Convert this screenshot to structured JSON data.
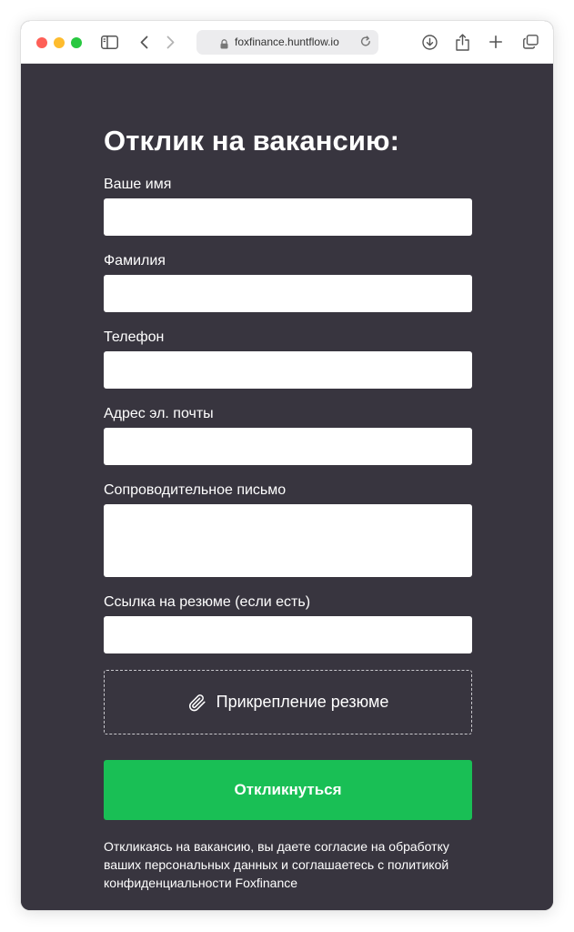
{
  "browser": {
    "url": "foxfinance.huntflow.io"
  },
  "form": {
    "title": "Отклик на вакансию:",
    "first_name": {
      "label": "Ваше имя",
      "value": ""
    },
    "last_name": {
      "label": "Фамилия",
      "value": ""
    },
    "phone": {
      "label": "Телефон",
      "value": ""
    },
    "email": {
      "label": "Адрес эл. почты",
      "value": ""
    },
    "cover_letter": {
      "label": "Сопроводительное письмо",
      "value": ""
    },
    "resume_link": {
      "label": "Ссылка на резюме (если есть)",
      "value": ""
    },
    "attach_label": "Прикрепление резюме",
    "submit_label": "Откликнуться",
    "consent_text": "Откликаясь на вакансию, вы даете согласие на обработку ваших персональных данных и соглашаетесь с политикой конфиденциальности Foxfinance"
  },
  "colors": {
    "page_background": "#38353f",
    "submit_button": "#19bf55",
    "field_background": "#ffffff"
  },
  "icons": {
    "toolbar": [
      "sidebar-icon",
      "back-chevron-icon",
      "forward-chevron-icon",
      "lock-icon",
      "reload-icon",
      "download-icon",
      "share-icon",
      "new-tab-icon",
      "tabs-overview-icon"
    ],
    "attach": "paperclip-icon"
  }
}
